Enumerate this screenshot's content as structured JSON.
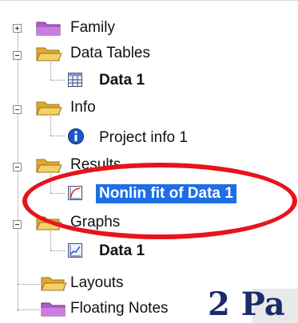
{
  "tree": {
    "family": {
      "label": "Family"
    },
    "data_tables": {
      "label": "Data Tables",
      "child": {
        "label": "Data 1"
      }
    },
    "info": {
      "label": "Info",
      "child": {
        "label": "Project info 1"
      }
    },
    "results": {
      "label": "Results",
      "child": {
        "label": "Nonlin fit of Data 1"
      }
    },
    "graphs": {
      "label": "Graphs",
      "child": {
        "label": "Data 1"
      }
    },
    "layouts": {
      "label": "Layouts"
    },
    "floating_notes": {
      "label": "Floating Notes"
    }
  },
  "overlay": {
    "text": "2 Pa"
  },
  "colors": {
    "selection": "#1e6ee6",
    "annotation": "#e8131b",
    "folder": "#f2c552",
    "family_folder": "#b05cc9"
  }
}
